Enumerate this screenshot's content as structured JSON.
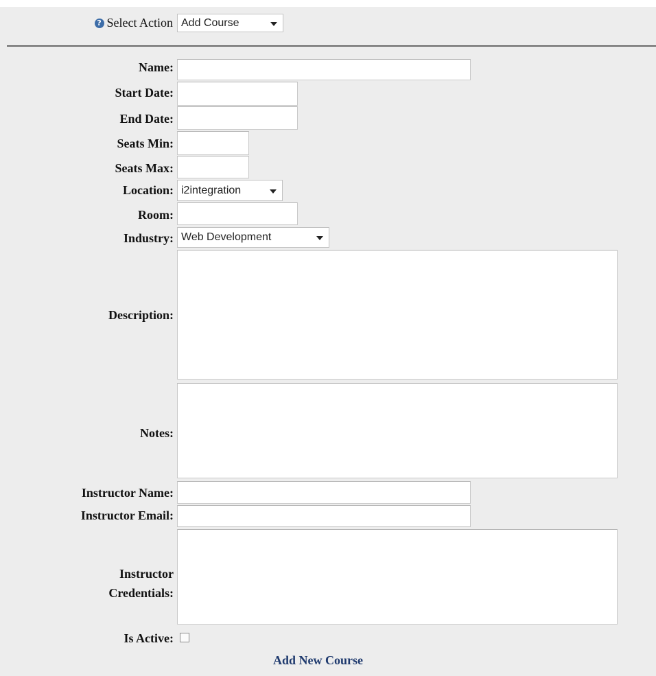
{
  "action": {
    "label": "Select Action",
    "icon": "question-circle-icon",
    "selected": "Add Course"
  },
  "form": {
    "name": {
      "label": "Name:",
      "value": ""
    },
    "start_date": {
      "label": "Start Date:",
      "value": ""
    },
    "end_date": {
      "label": "End Date:",
      "value": ""
    },
    "seats_min": {
      "label": "Seats Min:",
      "value": ""
    },
    "seats_max": {
      "label": "Seats Max:",
      "value": ""
    },
    "location": {
      "label": "Location:",
      "selected": "i2integration"
    },
    "room": {
      "label": "Room:",
      "value": ""
    },
    "industry": {
      "label": "Industry:",
      "selected": "Web Development"
    },
    "description": {
      "label": "Description:",
      "value": ""
    },
    "notes": {
      "label": "Notes:",
      "value": ""
    },
    "instructor_name": {
      "label": "Instructor Name:",
      "value": ""
    },
    "instructor_email": {
      "label": "Instructor Email:",
      "value": ""
    },
    "instructor_credentials": {
      "label_line1": "Instructor",
      "label_line2": "Credentials:",
      "value": ""
    },
    "is_active": {
      "label": "Is Active:",
      "checked": false
    }
  },
  "submit_label": "Add New Course",
  "colors": {
    "page_background": "#ededed",
    "link": "#1f3a6e",
    "help_icon": "#3d6da8",
    "divider": "#6a6a6a"
  }
}
